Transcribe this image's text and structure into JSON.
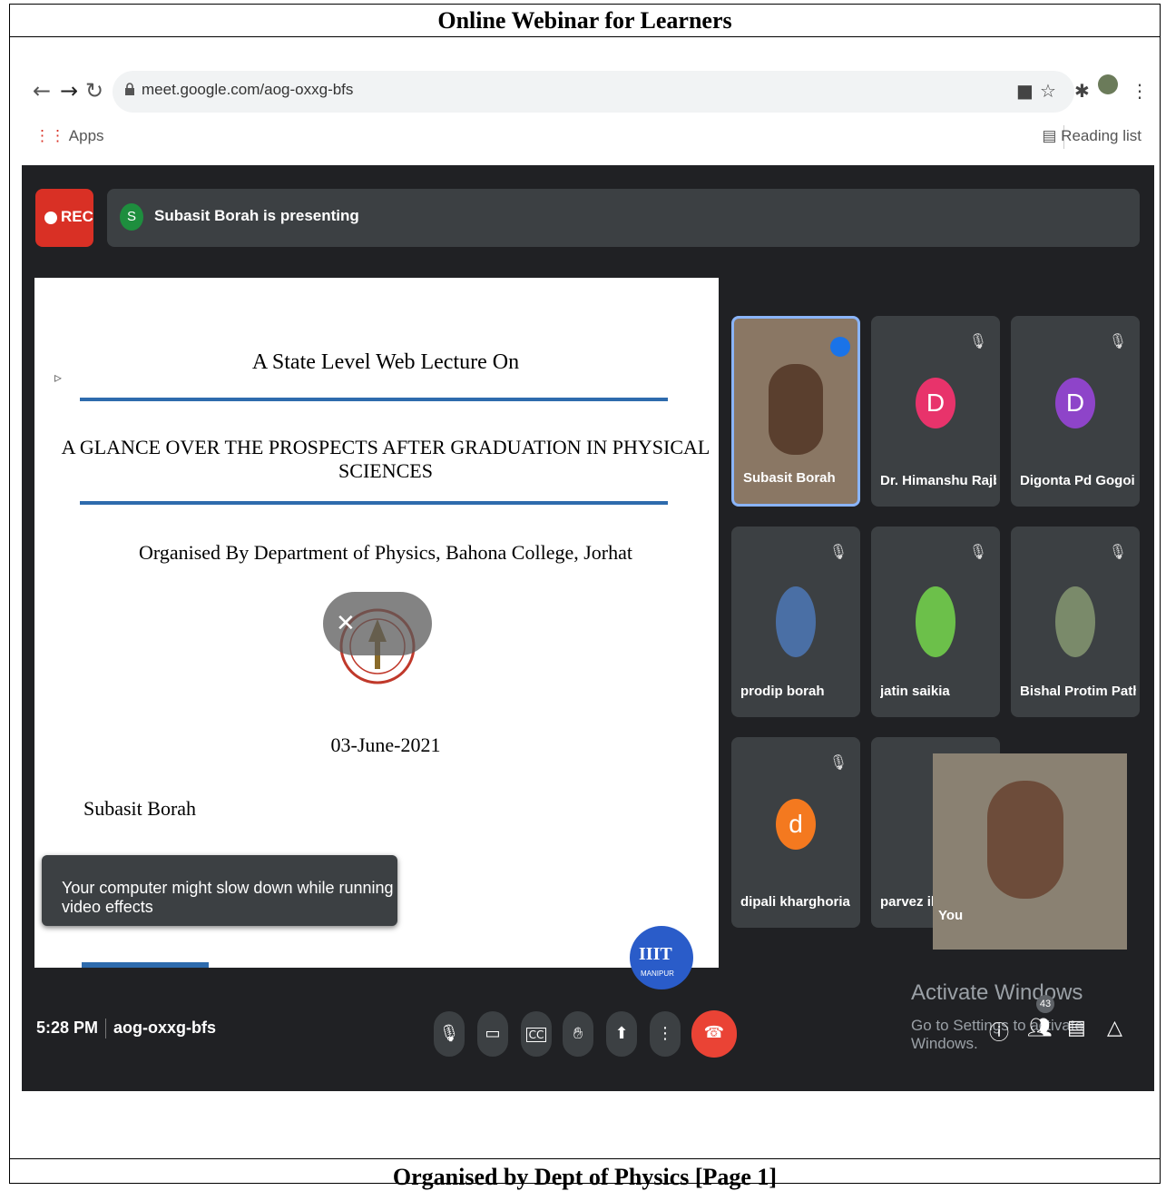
{
  "document": {
    "title": "Online Webinar for Learners",
    "footer": "Organised by Dept of Physics [Page 1]"
  },
  "browser": {
    "url": "meet.google.com/aog-oxxg-bfs",
    "bookmarks_apps": "Apps",
    "reading_list": "Reading list"
  },
  "meet": {
    "rec_label": "REC",
    "presenter_initial": "S",
    "presenting_text": "Subasit Borah is presenting",
    "time": "5:28 PM",
    "meeting_code": "aog-oxxg-bfs",
    "toast": "Your computer might slow down while running video effects",
    "participant_count": "43",
    "watermark_title": "Activate Windows",
    "watermark_sub": "Go to Settings to activate Windows."
  },
  "slide": {
    "heading": "A State Level Web Lecture On",
    "topic": "A GLANCE OVER THE PROSPECTS AFTER GRADUATION IN PHYSICAL SCIENCES",
    "organiser": "Organised By Department of Physics, Bahona College, Jorhat",
    "date": "03-June-2021",
    "speaker": "Subasit Borah",
    "logo_text": "IIIT",
    "logo_sub": "MANIPUR"
  },
  "participants": [
    {
      "name": "Subasit Borah",
      "type": "video",
      "speaking": true
    },
    {
      "name": "Dr. Himanshu Rajb...",
      "initial": "D",
      "color": "#e8336b",
      "muted": true
    },
    {
      "name": "Digonta Pd Gogoi",
      "initial": "D",
      "color": "#8e44c9",
      "muted": true
    },
    {
      "name": "prodip borah",
      "type": "photo",
      "muted": true
    },
    {
      "name": "jatin saikia",
      "type": "photo",
      "muted": true
    },
    {
      "name": "Bishal Protim Path...",
      "type": "photo",
      "muted": true
    },
    {
      "name": "dipali kharghoria",
      "initial": "d",
      "color": "#f4791f",
      "muted": true
    },
    {
      "name": "parvez ill",
      "type": "partial"
    }
  ],
  "self_view_label": "You"
}
